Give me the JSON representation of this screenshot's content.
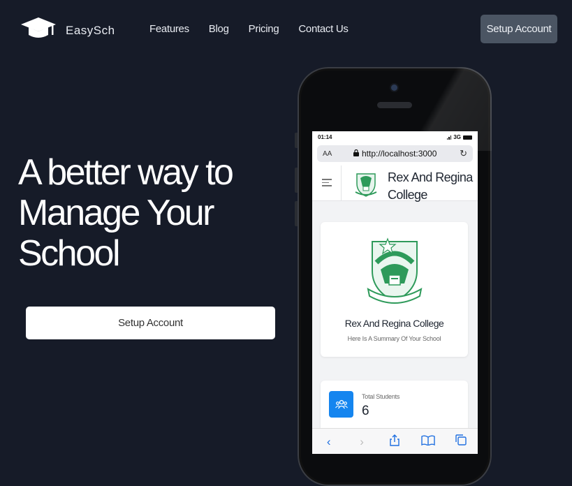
{
  "brand": {
    "name": "EasySch"
  },
  "nav": {
    "links": [
      "Features",
      "Blog",
      "Pricing",
      "Contact Us"
    ],
    "cta": "Setup Account"
  },
  "hero": {
    "lines": [
      "A better way to",
      "Manage Your",
      "School"
    ],
    "cta": "Setup Account"
  },
  "phone": {
    "status": {
      "time": "01:14",
      "network": "3G"
    },
    "browser": {
      "aa": "AA",
      "url": "http://localhost:3000"
    },
    "app": {
      "college_name": "Rex And Regina College",
      "summary_title": "Rex And Regina College",
      "summary_subtitle": "Here Is A Summary Of Your School",
      "stat_label": "Total Students",
      "stat_value": "6"
    },
    "toolbar_icons": [
      "back-icon",
      "forward-icon",
      "share-icon",
      "bookmarks-icon",
      "tabs-icon"
    ]
  },
  "colors": {
    "background": "#161b28",
    "nav_button": "#4b5563",
    "stat_icon": "#1585ef",
    "crest_green": "#2e9a5a"
  }
}
